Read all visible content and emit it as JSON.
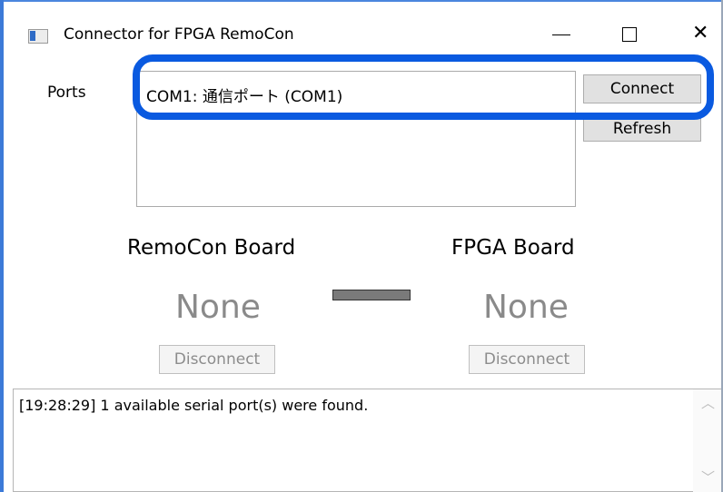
{
  "window": {
    "title": "Connector for FPGA RemoCon",
    "icon": "app-window-icon",
    "controls": {
      "minimize": "minimize-icon",
      "maximize": "maximize-icon",
      "close_glyph": "✕"
    }
  },
  "ports": {
    "label": "Ports",
    "items": [
      "COM1: 通信ポート (COM1)"
    ],
    "connect_label": "Connect",
    "refresh_label": "Refresh"
  },
  "boards": {
    "remocon": {
      "title": "RemoCon Board",
      "status": "None",
      "disconnect_label": "Disconnect"
    },
    "fpga": {
      "title": "FPGA Board",
      "status": "None",
      "disconnect_label": "Disconnect"
    }
  },
  "log": {
    "lines": [
      "[19:28:29] 1 available serial port(s) were found."
    ]
  },
  "colors": {
    "highlight": "#0a5ae0",
    "status_text": "#8a8a8a",
    "connector": "#7a7a7a"
  }
}
